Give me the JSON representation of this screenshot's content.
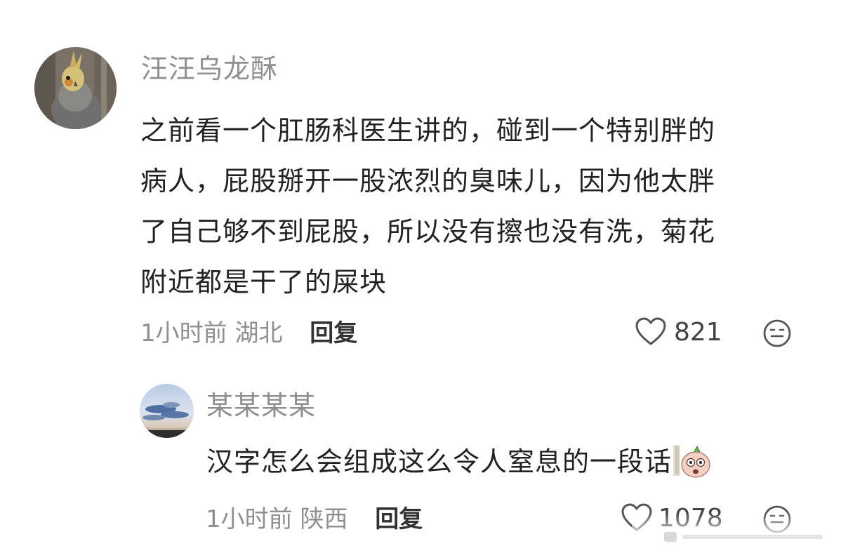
{
  "main_comment": {
    "username": "汪汪乌龙酥",
    "text_lines": [
      "之前看一个肛肠科医生讲的，碰到一个特别胖的",
      "病人，屁股掰开一股浓烈的臭味儿，因为他太胖",
      "了自己够不到屁股，所以没有擦也没有洗，菊花",
      "附近都是干了的屎块"
    ],
    "time": "1小时前",
    "location": "湖北",
    "reply_label": "回复",
    "like_count": "821",
    "like_icon": "heart-outline-icon",
    "emoji_icon": "neutral-face-icon"
  },
  "reply_comment": {
    "username": "某某某某",
    "text": "汉字怎么会组成这么令人窒息的一段话",
    "sticker": "shocked-cartoon-sticker",
    "time": "1小时前",
    "location": "陕西",
    "reply_label": "回复",
    "like_count": "1078",
    "like_icon": "heart-outline-icon",
    "emoji_icon": "neutral-face-icon"
  },
  "colors": {
    "username": "#8f8f8f",
    "body_text": "#222222",
    "meta_text": "#8f8f8f",
    "reply_link": "#333333",
    "icon": "#555555"
  }
}
